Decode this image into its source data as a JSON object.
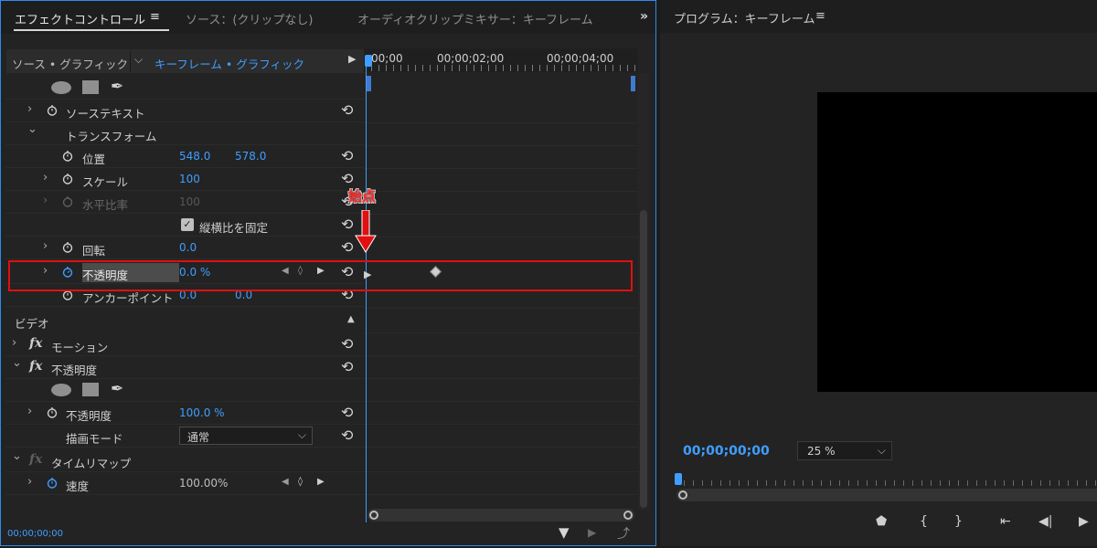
{
  "effect_controls": {
    "tabs": {
      "effect_controls": "エフェクトコントロール",
      "menu": "≡",
      "source": "ソース：(クリップなし)",
      "audio_mixer": "オーディオクリップミキサー：キーフレーム",
      "more": "»"
    },
    "header": {
      "source": "ソース • グラフィック",
      "chevron": "⌵",
      "keyframe": "キーフレーム • グラフィック",
      "play": "▶"
    },
    "rows": {
      "source_text": "ソーステキスト",
      "transform": "トランスフォーム",
      "position": "位置",
      "position_x": "548.0",
      "position_y": "578.0",
      "scale": "スケール",
      "scale_value": "100",
      "scale_width": "水平比率",
      "scale_width_value": "100",
      "uniform_scale": "縦横比を固定",
      "rotation": "回転",
      "rotation_value": "0.0",
      "opacity": "不透明度",
      "opacity_value": "0.0 %",
      "anchor_point": "アンカーポイント",
      "anchor_x": "0.0",
      "anchor_y": "0.0"
    },
    "video_section": {
      "label": "ビデオ",
      "motion": "モーション",
      "opacity": "不透明度",
      "opacity_value": "100.0 %",
      "blend_mode": "描画モード",
      "blend_value": "通常",
      "time_remap": "タイムリマップ",
      "speed": "速度",
      "speed_value": "100.00%"
    },
    "timeline": {
      "tc1": "00;00",
      "tc2": "00;00;02;00",
      "tc3": "00;00;04;00"
    },
    "footer_timecode": "00;00;00;00"
  },
  "annotation": {
    "label": "始点",
    "color": "#e01010"
  },
  "program_monitor": {
    "title": "プログラム：キーフレーム",
    "menu": "≡",
    "timecode": "00;00;00;00",
    "zoom": "25 %"
  },
  "icons": {
    "reset": "⟲",
    "twirl_closed": "›",
    "twirl_open": "⌄",
    "fx": "fx",
    "check": "✓",
    "kf_prev": "◀",
    "kf_add": "◊",
    "kf_next": "▶",
    "dropdown": "⌵",
    "filter": "▼",
    "export": "⤴",
    "pm_marker": "⬟",
    "pm_in": "{",
    "pm_out": "}",
    "pm_go_in": "⇤",
    "pm_step_back": "◀|",
    "pm_play": "▶"
  },
  "colors": {
    "accent": "#3f9eff",
    "panel": "#232323",
    "highlight_border": "#e01010"
  }
}
